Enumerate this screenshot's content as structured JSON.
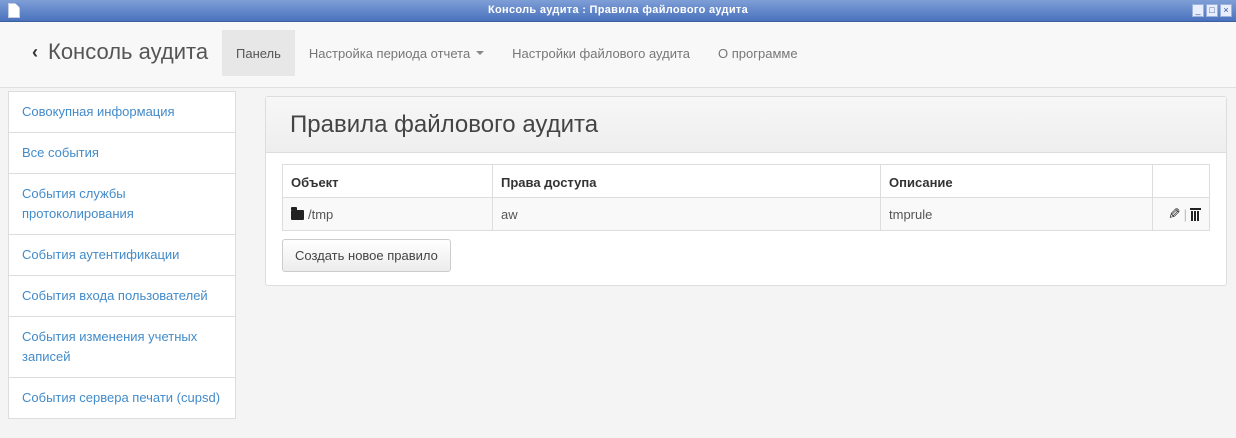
{
  "window": {
    "title": "Консоль аудита : Правила файлового аудита"
  },
  "brand": {
    "label": "Консоль аудита",
    "back_icon": "chevron-left-icon"
  },
  "nav": {
    "panel": "Панель",
    "report_period": "Настройка периода отчета",
    "file_audit_settings": "Настройки файлового аудита",
    "about": "О программе"
  },
  "sidebar": {
    "items": [
      {
        "label": "Совокупная информация"
      },
      {
        "label": "Все события"
      },
      {
        "label": "События службы протоколирования"
      },
      {
        "label": "События аутентификации"
      },
      {
        "label": "События входа пользователей"
      },
      {
        "label": "События изменения учетных записей"
      },
      {
        "label": "События сервера печати (cupsd)"
      }
    ]
  },
  "main": {
    "title": "Правила файлового аудита",
    "table": {
      "headers": {
        "object": "Объект",
        "access": "Права доступа",
        "description": "Описание",
        "actions": ""
      },
      "rows": [
        {
          "object": "/tmp",
          "access": "aw",
          "description": "tmprule"
        }
      ]
    },
    "create_button": "Создать новое правило"
  },
  "colors": {
    "link": "#428bca",
    "titlebar": "#4a72bd"
  }
}
